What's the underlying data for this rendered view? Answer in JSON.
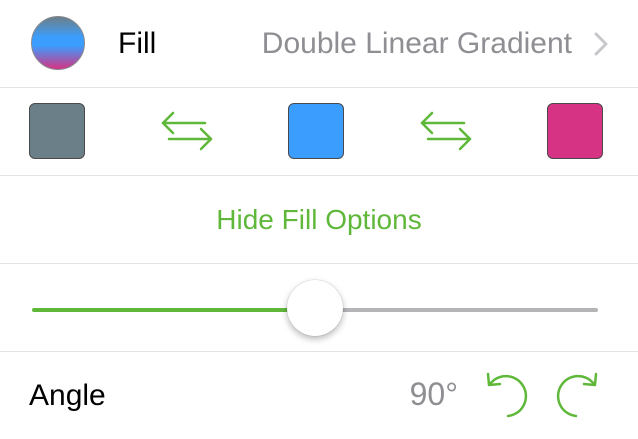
{
  "fill": {
    "label": "Fill",
    "value": "Double Linear Gradient",
    "swatch_colors": [
      "#6b7f89",
      "#3b9eff",
      "#d63384"
    ]
  },
  "icons": {
    "chevron": "chevron-right-icon",
    "swap": "swap-arrows-icon",
    "rotate_ccw": "rotate-counterclockwise-icon",
    "rotate_cw": "rotate-clockwise-icon"
  },
  "color_stops": [
    {
      "name": "start",
      "color": "#6b7f89"
    },
    {
      "name": "middle",
      "color": "#3b9eff"
    },
    {
      "name": "end",
      "color": "#d63384"
    }
  ],
  "hide_options": {
    "label": "Hide Fill Options"
  },
  "slider": {
    "value": 0.5
  },
  "angle": {
    "label": "Angle",
    "value": "90°"
  },
  "colors": {
    "accent": "#5fb83a",
    "secondary_text": "#8e8e93",
    "track": "#b5b5b8"
  }
}
